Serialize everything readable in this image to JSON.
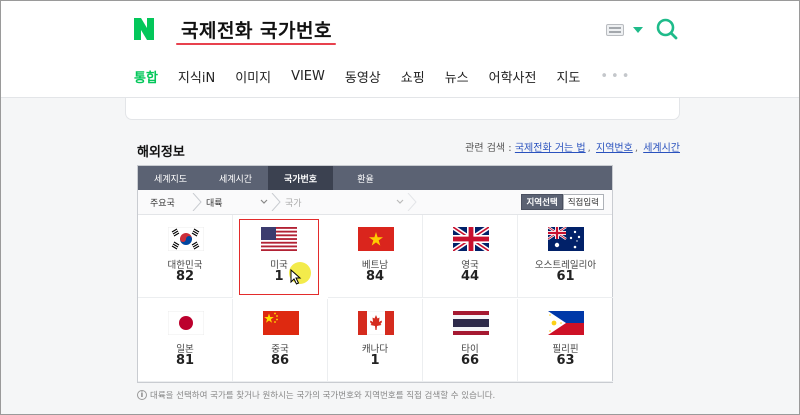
{
  "search": {
    "query": "국제전화 국가번호",
    "logo_letter": "N"
  },
  "nav": {
    "tabs": [
      "통합",
      "지식iN",
      "이미지",
      "VIEW",
      "동영상",
      "쇼핑",
      "뉴스",
      "어학사전",
      "지도"
    ],
    "active_index": 0,
    "more": "•••"
  },
  "section": {
    "title": "해외정보",
    "related_label": "관련 검색 :",
    "related_links": [
      "국제전화 거는 법",
      "지역번호",
      "세계시간"
    ]
  },
  "panel": {
    "tabs": [
      "세계지도",
      "세계시간",
      "국가번호",
      "환율"
    ],
    "active_tab": 2,
    "crumbs": [
      "주요국",
      "대륙",
      "국가"
    ],
    "mode_buttons": [
      "지역선택",
      "직접입력"
    ],
    "selected_mode": 0
  },
  "countries": [
    {
      "name": "대한민국",
      "code": "82",
      "flag": "korea"
    },
    {
      "name": "미국",
      "code": "1",
      "flag": "usa"
    },
    {
      "name": "베트남",
      "code": "84",
      "flag": "vietnam"
    },
    {
      "name": "영국",
      "code": "44",
      "flag": "uk"
    },
    {
      "name": "오스트레일리아",
      "code": "61",
      "flag": "australia"
    },
    {
      "name": "일본",
      "code": "81",
      "flag": "japan"
    },
    {
      "name": "중국",
      "code": "86",
      "flag": "china"
    },
    {
      "name": "캐나다",
      "code": "1",
      "flag": "canada"
    },
    {
      "name": "타이",
      "code": "66",
      "flag": "thailand"
    },
    {
      "name": "필리핀",
      "code": "63",
      "flag": "philippines"
    }
  ],
  "selected_country": 1,
  "footnote": "대륙을 선택하여 국가를 찾거나 원하시는 국가의 국가번호와 지역번호를 직접 검색할 수 있습니다.",
  "colors": {
    "brand": "#03c75a",
    "underline": "#e8414e",
    "tab_bar": "#5b6273",
    "link": "#2a52be"
  }
}
